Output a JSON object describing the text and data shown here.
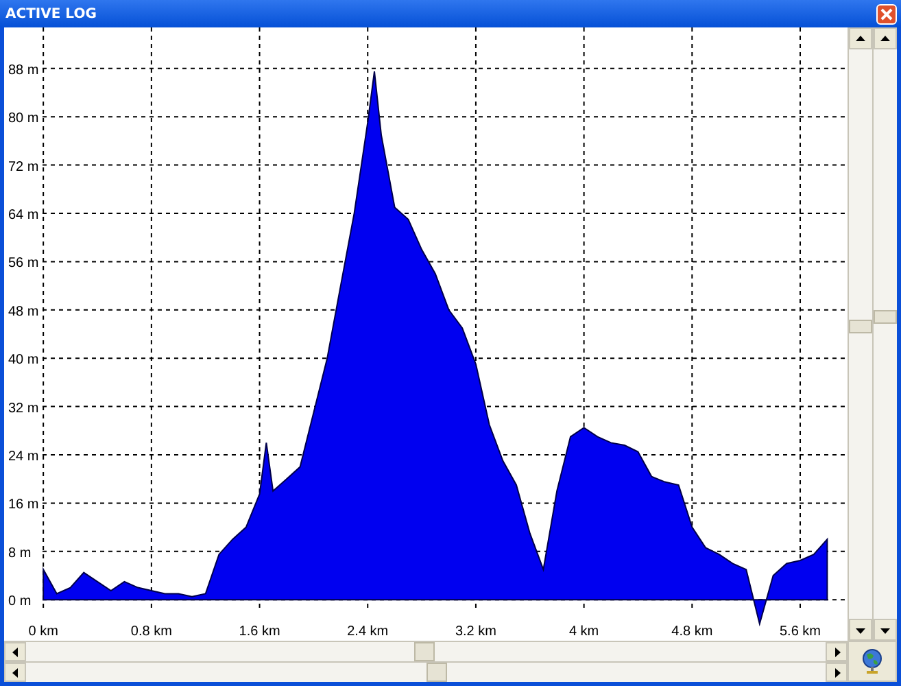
{
  "window": {
    "title": "ACTIVE LOG"
  },
  "chart_data": {
    "type": "area",
    "x": [
      0,
      0.1,
      0.2,
      0.3,
      0.4,
      0.5,
      0.6,
      0.7,
      0.8,
      0.9,
      1.0,
      1.1,
      1.2,
      1.3,
      1.4,
      1.5,
      1.6,
      1.65,
      1.7,
      1.8,
      1.9,
      2.0,
      2.1,
      2.2,
      2.3,
      2.4,
      2.45,
      2.5,
      2.6,
      2.7,
      2.8,
      2.9,
      3.0,
      3.1,
      3.2,
      3.3,
      3.4,
      3.5,
      3.6,
      3.7,
      3.8,
      3.9,
      4.0,
      4.1,
      4.2,
      4.3,
      4.4,
      4.5,
      4.6,
      4.7,
      4.8,
      4.9,
      5.0,
      5.1,
      5.2,
      5.3,
      5.4,
      5.5,
      5.6,
      5.7,
      5.8
    ],
    "values": [
      5,
      1,
      2,
      4.5,
      3,
      1.5,
      3,
      2,
      1.5,
      1,
      1,
      0.5,
      1,
      7.5,
      10,
      12,
      17.5,
      26,
      18,
      20,
      22,
      31,
      40,
      52,
      64,
      79,
      87.5,
      77,
      65,
      63,
      58,
      54,
      48,
      45,
      39,
      29,
      23,
      19,
      11,
      5,
      18,
      27,
      28.5,
      27,
      26,
      25.6,
      24.5,
      20.4,
      19.5,
      19,
      12,
      8.6,
      7.5,
      6,
      5,
      -4,
      4,
      6,
      6.5,
      7.5,
      10
    ],
    "grid": true,
    "xlim": [
      -0.29,
      5.95
    ],
    "ylim": [
      -6.8,
      94.8
    ],
    "xticks": [
      {
        "value": 0,
        "label": "0 km"
      },
      {
        "value": 0.8,
        "label": "0.8 km"
      },
      {
        "value": 1.6,
        "label": "1.6 km"
      },
      {
        "value": 2.4,
        "label": "2.4 km"
      },
      {
        "value": 3.2,
        "label": "3.2 km"
      },
      {
        "value": 4,
        "label": "4 km"
      },
      {
        "value": 4.8,
        "label": "4.8 km"
      },
      {
        "value": 5.6,
        "label": "5.6 km"
      }
    ],
    "yticks": [
      {
        "value": 0,
        "label": "0 m"
      },
      {
        "value": 8,
        "label": "8 m"
      },
      {
        "value": 16,
        "label": "16 m"
      },
      {
        "value": 24,
        "label": "24 m"
      },
      {
        "value": 32,
        "label": "32 m"
      },
      {
        "value": 40,
        "label": "40 m"
      },
      {
        "value": 48,
        "label": "48 m"
      },
      {
        "value": 56,
        "label": "56 m"
      },
      {
        "value": 64,
        "label": "64 m"
      },
      {
        "value": 72,
        "label": "72 m"
      },
      {
        "value": 80,
        "label": "80 m"
      },
      {
        "value": 88,
        "label": "88 m"
      }
    ]
  }
}
